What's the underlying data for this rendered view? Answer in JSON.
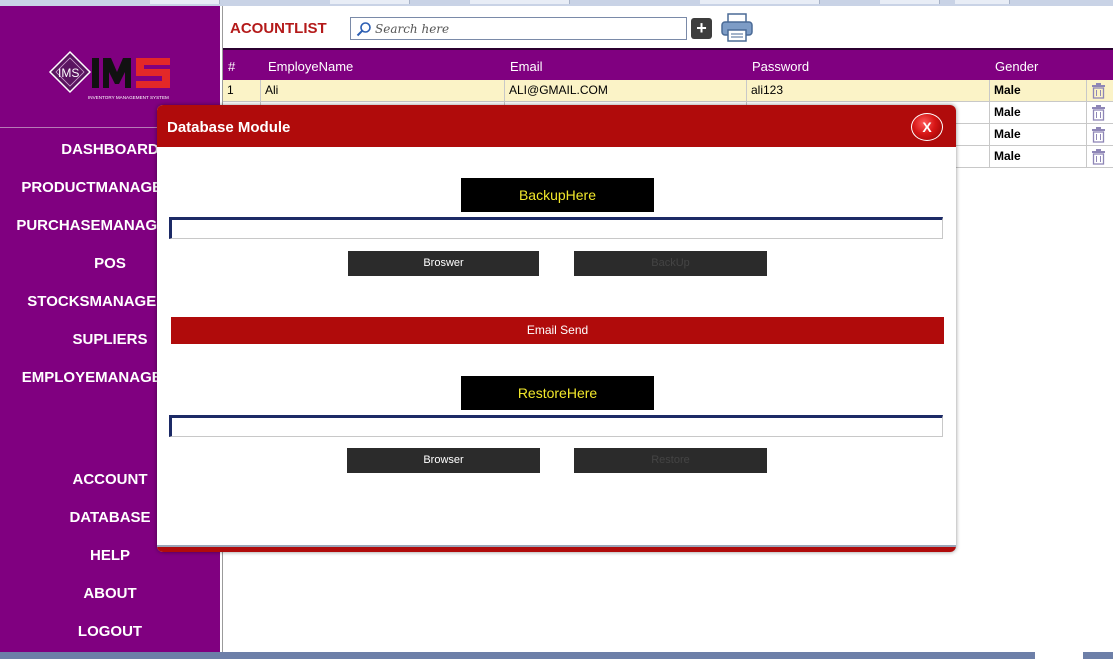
{
  "app": {
    "title": "ACOUNTLIST",
    "logo_text": "IMS",
    "logo_subtitle": "INVENTORY MANAGEMENT SYSTEM"
  },
  "sidebar": {
    "items": [
      {
        "label": "DASHBOARD"
      },
      {
        "label": "PRODUCTMANAGEMENT"
      },
      {
        "label": "PURCHASEMANAGEMENT"
      },
      {
        "label": "POS"
      },
      {
        "label": "STOCKSMANAGEMENT"
      },
      {
        "label": "SUPLIERS"
      },
      {
        "label": "EMPLOYEMANAGEMENT"
      },
      {
        "label": "ACCOUNT"
      },
      {
        "label": "DATABASE"
      },
      {
        "label": "HELP"
      },
      {
        "label": "ABOUT"
      },
      {
        "label": "LOGOUT"
      }
    ]
  },
  "toolbar": {
    "search_placeholder": "Search here",
    "add_icon": "plus-icon",
    "print_icon": "printer-icon"
  },
  "table": {
    "columns": [
      "#",
      "EmployeName",
      "Email",
      "Password",
      "Gender"
    ],
    "rows": [
      {
        "num": "1",
        "name": "Ali",
        "email": "ALI@GMAIL.COM",
        "password": "ali123",
        "gender": "Male"
      },
      {
        "num": "",
        "name": "",
        "email": "",
        "password": "",
        "gender": "Male"
      },
      {
        "num": "",
        "name": "",
        "email": "",
        "password": "",
        "gender": "Male"
      },
      {
        "num": "",
        "name": "",
        "email": "",
        "password": "",
        "gender": "Male"
      }
    ],
    "delete_icon": "trash-icon"
  },
  "modal": {
    "title": "Database Module",
    "close_label": "X",
    "backup": {
      "label": "BackupHere",
      "path_value": "",
      "browse_label": "Broswer",
      "action_label": "BackUp"
    },
    "email_label": "Email Send",
    "restore": {
      "label": "RestoreHere",
      "path_value": "",
      "browse_label": "Browser",
      "action_label": "Restore"
    }
  },
  "colors": {
    "sidebar": "#800080",
    "accent_red": "#b00b0b",
    "title_red": "#b41a1a",
    "highlight_row": "#fbf3c7",
    "label_yellow": "#f2e82b"
  }
}
